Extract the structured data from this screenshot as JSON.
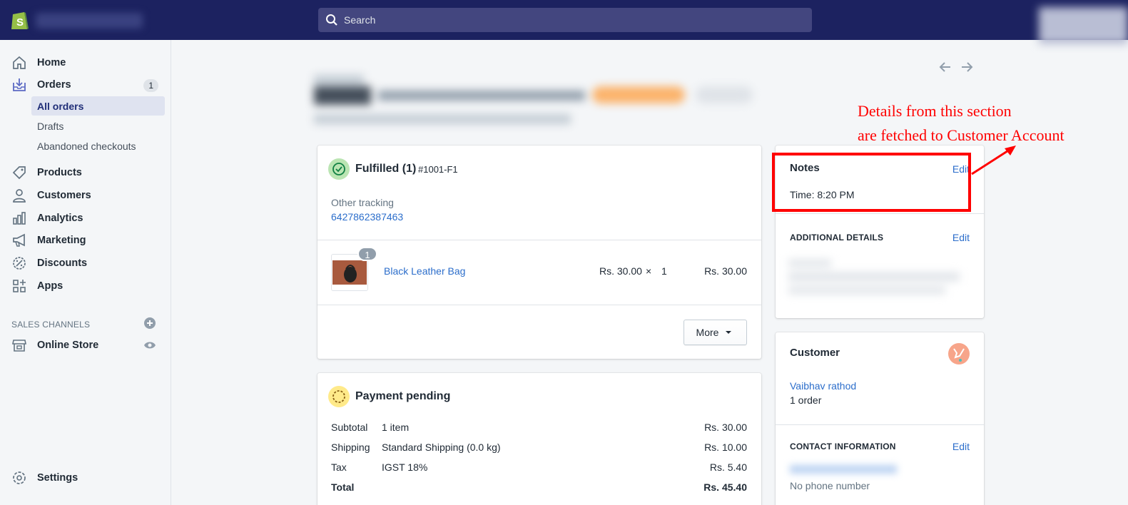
{
  "topbar": {
    "search_placeholder": "Search"
  },
  "sidebar": {
    "items": [
      {
        "label": "Home"
      },
      {
        "label": "Orders",
        "badge": "1"
      },
      {
        "label": "Products"
      },
      {
        "label": "Customers"
      },
      {
        "label": "Analytics"
      },
      {
        "label": "Marketing"
      },
      {
        "label": "Discounts"
      },
      {
        "label": "Apps"
      }
    ],
    "order_subitems": [
      "All orders",
      "Drafts",
      "Abandoned checkouts"
    ],
    "sales_channels_title": "SALES CHANNELS",
    "online_store": "Online Store",
    "settings": "Settings"
  },
  "fulfilled": {
    "title": "Fulfilled (1)",
    "fulfillment_id": "#1001-F1",
    "tracking_label": "Other tracking",
    "tracking_number": "6427862387463",
    "item_qty_badge": "1",
    "item_name": "Black Leather Bag",
    "item_price": "Rs. 30.00",
    "item_times": "×",
    "item_qty": "1",
    "item_total": "Rs. 30.00",
    "more_button": "More"
  },
  "payment": {
    "title": "Payment pending",
    "rows": [
      {
        "label": "Subtotal",
        "desc": "1 item",
        "amount": "Rs. 30.00"
      },
      {
        "label": "Shipping",
        "desc": "Standard Shipping (0.0 kg)",
        "amount": "Rs. 10.00"
      },
      {
        "label": "Tax",
        "desc": "IGST 18%",
        "amount": "Rs. 5.40"
      },
      {
        "label": "Total",
        "desc": "",
        "amount": "Rs. 45.40"
      }
    ]
  },
  "notes": {
    "title": "Notes",
    "edit": "Edit",
    "body": "Time: 8:20 PM"
  },
  "additional": {
    "title": "ADDITIONAL DETAILS",
    "edit": "Edit"
  },
  "customer": {
    "title": "Customer",
    "name": "Vaibhav rathod",
    "orders": "1 order",
    "contact_title": "CONTACT INFORMATION",
    "contact_edit": "Edit",
    "phone": "No phone number"
  },
  "annotation": {
    "line1": "Details from this section",
    "line2": "are fetched to Customer Account"
  },
  "colors": {
    "topbar": "#1c2260",
    "accent": "#5c6ac4",
    "link": "#2c6ecb",
    "annotation": "#ff0000"
  }
}
